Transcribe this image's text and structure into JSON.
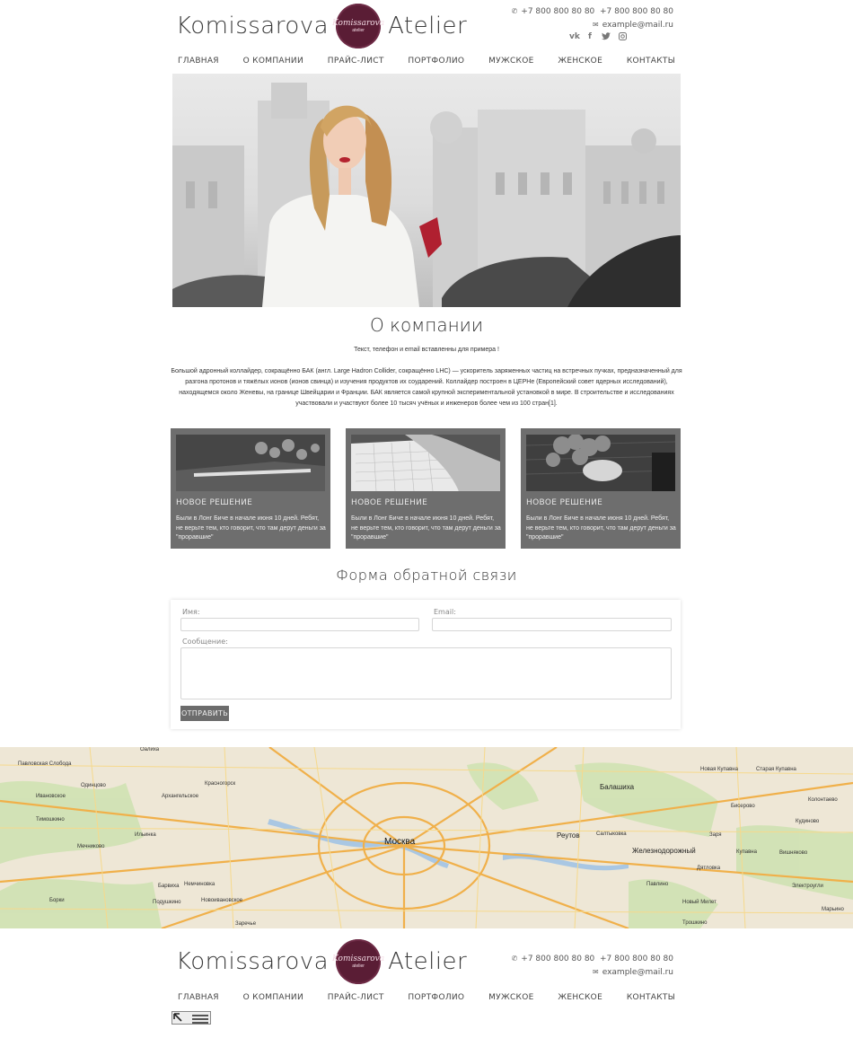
{
  "header": {
    "brand_left": "Komissarova",
    "brand_logo_script": "Komissarova",
    "brand_logo_sub": "atelier",
    "brand_right": "Atelier",
    "phone_1": "+7 800 800 80 80",
    "phone_2": "+7 800 800 80 80",
    "email": "example@mail.ru",
    "socials": [
      "vk",
      "f",
      "twitter",
      "instagram"
    ]
  },
  "nav": {
    "items": [
      "ГЛАВНАЯ",
      "О КОМПАНИИ",
      "ПРАЙС-ЛИСТ",
      "ПОРТФОЛИО",
      "МУЖСКОЕ",
      "ЖЕНСКОЕ",
      "КОНТАКТЫ"
    ]
  },
  "about": {
    "title": "О компании",
    "lead": "Текст, телефон и email вставленны для примера !",
    "text": "Большой адронный коллайдер, сокращённо БАК (англ. Large Hadron Collider, сокращённо LHC) — ускоритель заряженных частиц на встречных пучках, предназначенный для разгона протонов и тяжёлых ионов (ионов свинца) и изучения продуктов их соударений. Коллайдер построен в ЦЕРНе (Европейский совет ядерных исследований), находящемся около Женевы, на границе Швейцарии и Франции. БАК является самой крупной экспериментальной установкой в мире. В строительстве и исследованиях участвовали и участвуют более 10 тысяч учёных и инженеров более чем из 100 стран[1]."
  },
  "cards": [
    {
      "title": "НОВОЕ РЕШЕНИЕ",
      "text": "Были в Лонг Биче в начале июня 10 дней. Ребят, не верьте тем, кто говорит, что там дерут деньги за \"проравшие\""
    },
    {
      "title": "НОВОЕ РЕШЕНИЕ",
      "text": "Были в Лонг Биче в начале июня 10 дней. Ребят, не верьте тем, кто говорит, что там дерут деньги за \"проравшие\""
    },
    {
      "title": "НОВОЕ РЕШЕНИЕ",
      "text": "Были в Лонг Биче в начале июня 10 дней. Ребят, не верьте тем, кто говорит, что там дерут деньги за \"проравшие\""
    }
  ],
  "form": {
    "title": "Форма обратной связи",
    "name_label": "Имя:",
    "email_label": "Email:",
    "message_label": "Сообщение:",
    "submit_label": "ОТПРАВИТЬ"
  },
  "map": {
    "labels": {
      "center": "Москва",
      "balashikha": "Балашиха",
      "reutov": "Реутов",
      "zheleznodorozhny": "Железнодорожный",
      "krasnogorsk": "Красногорск",
      "arkhangelskoe": "Архангельское",
      "barvikha": "Барвиха",
      "nemchinovka": "Немчиновка",
      "novoivankovskoe": "Новоивановское",
      "saltykovka": "Салтыковка",
      "staraya_kupavna": "Старая Купавна",
      "kupavna": "Купавна",
      "kudinovo": "Кудиново",
      "elektrougli": "Электроугли",
      "zarya": "Заря",
      "pavlovskaya_sloboda": "Павловская Слобода",
      "olalikha": "Оалиха",
      "ilyinka": "Ильинка",
      "zarechye": "Заречье",
      "mechnikovo": "Мечниково",
      "timoshkino": "Тимошкино",
      "novaya_kupavna": "Новая Купавна",
      "novye_mityshi": "Новый Милет",
      "dyatlovka": "Дятловка",
      "vishnyakovo": "Вишняково",
      "koloritnoe": "Колонтаево",
      "troshkino": "Трошкино",
      "biserovo": "Бисерово",
      "palpino": "Павлино",
      "ivanovskoe": "Ивановское",
      "odintsovo": "Одинцово",
      "borki": "Борки",
      "podushkino": "Подушкино",
      "mamyr": "Марьино"
    }
  },
  "footer": {
    "brand_left": "Komissarova",
    "brand_logo_script": "Komissarova",
    "brand_logo_sub": "atelier",
    "brand_right": "Atelier",
    "phone_1": "+7 800 800 80 80",
    "phone_2": "+7 800 800 80 80",
    "email": "example@mail.ru"
  }
}
